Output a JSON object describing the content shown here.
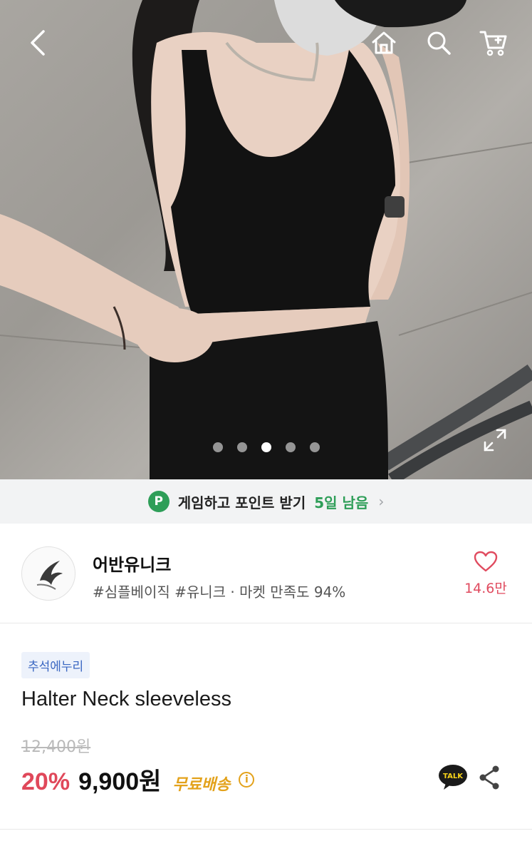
{
  "hero": {
    "slide_count": 5,
    "active_slide_index": 2
  },
  "game_banner": {
    "badge": "P",
    "text": "게임하고 포인트 받기",
    "days_left": "5일 남음",
    "arrow": "›"
  },
  "store": {
    "name": "어반유니크",
    "meta": "#심플베이직 #유니크 · 마켓 만족도 94%",
    "like_count": "14.6만"
  },
  "product": {
    "promo_tag": "추석에누리",
    "name": "Halter Neck sleeveless",
    "original_price": "12,400원",
    "discount": "20%",
    "sale_price": "9,900원",
    "shipping": "무료배송",
    "info_glyph": "i",
    "talk_label": "TALK"
  },
  "colors": {
    "accent_red": "#e0485a",
    "point_green": "#2e9e58",
    "shipping_orange": "#e3a21b",
    "tag_blue": "#3a67c2"
  }
}
